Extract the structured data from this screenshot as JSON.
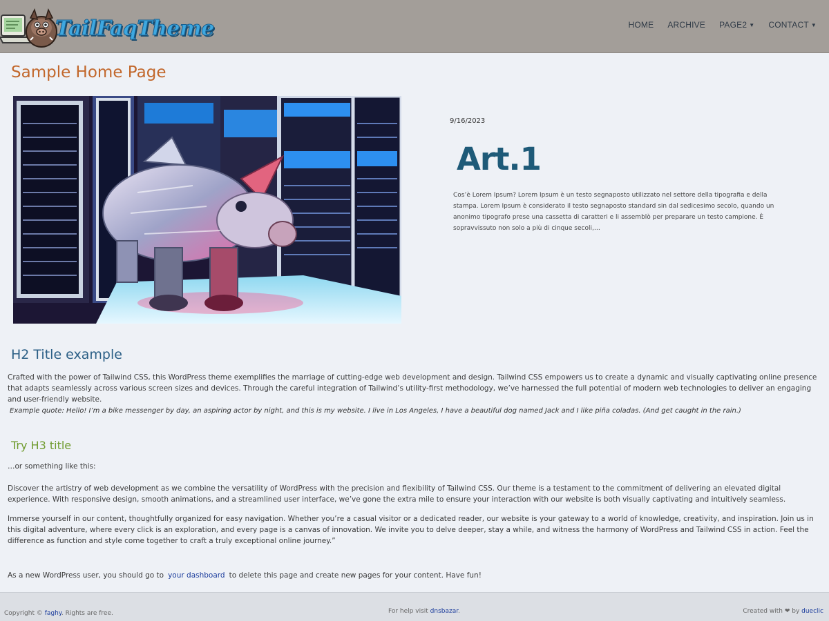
{
  "header": {
    "logo_text": "TailFaqTheme",
    "nav": [
      {
        "label": "HOME",
        "has_dropdown": false
      },
      {
        "label": "ARCHIVE",
        "has_dropdown": false
      },
      {
        "label": "PAGE2",
        "has_dropdown": true
      },
      {
        "label": "CONTACT",
        "has_dropdown": true
      }
    ],
    "dropdown_glyph": "▼"
  },
  "main": {
    "page_title": "Sample Home Page",
    "post": {
      "date": "9/16/2023",
      "title": "Art.1",
      "excerpt": "Cos’è Lorem Ipsum? Lorem Ipsum è un testo segnaposto utilizzato nel settore della tipografia e della stampa. Lorem Ipsum è considerato il testo segnaposto standard sin dal sedicesimo secolo, quando un anonimo tipografo prese una cassetta di caratteri e li assemblò per preparare un testo campione. È sopravvissuto non solo a più di cinque secoli,…"
    },
    "h2": "H2 Title example",
    "p1": "Crafted with the power of Tailwind CSS, this WordPress theme exemplifies the marriage of cutting-edge web development and design. Tailwind CSS empowers us to create a dynamic and visually captivating online presence that adapts seamlessly across various screen sizes and devices. Through the careful integration of Tailwind’s utility-first methodology, we’ve harnessed the full potential of modern web technologies to deliver an engaging and user-friendly website.",
    "quote": "Example quote: Hello! I’m a bike messenger by day, an aspiring actor by night, and this is my website. I live in Los Angeles, I have a beautiful dog named Jack and I like piña coladas. (And get caught in the rain.)",
    "h3": "Try H3 title",
    "p_or": "…or something like this:",
    "p2": "Discover the artistry of web development as we combine the versatility of WordPress with the precision and flexibility of Tailwind CSS. Our theme is a testament to the commitment of delivering an elevated digital experience. With responsive design, smooth animations, and a streamlined user interface, we’ve gone the extra mile to ensure your interaction with our website is both visually captivating and intuitively seamless.",
    "p3": "Immerse yourself in our content, thoughtfully organized for easy navigation. Whether you’re a casual visitor or a dedicated reader, our website is your gateway to a world of knowledge, creativity, and inspiration. Join us in this digital adventure, where every click is an exploration, and every page is a canvas of innovation. We invite you to delve deeper, stay a while, and witness the harmony of WordPress and Tailwind CSS in action. Feel the difference as function and style come together to craft a truly exceptional online journey.”",
    "p4_before": "As a new WordPress user, you should go to",
    "p4_link": "your dashboard",
    "p4_after": "to delete this page and create new pages for your content. Have fun!"
  },
  "footer": {
    "left_prefix": "Copyright ©",
    "left_link": "faghy",
    "left_suffix": ". Rights are free.",
    "center_prefix": "For help visit",
    "center_link": "dnsbazar",
    "center_suffix": ".",
    "right_prefix": "Created with ❤ by",
    "right_link": "dueclic"
  },
  "colors": {
    "header_bg": "#a39e99",
    "page_title": "#c2672b",
    "post_title": "#1e5a78",
    "h2": "#2b5f86",
    "h3": "#6f9b2d",
    "link": "#1b3c9c"
  }
}
